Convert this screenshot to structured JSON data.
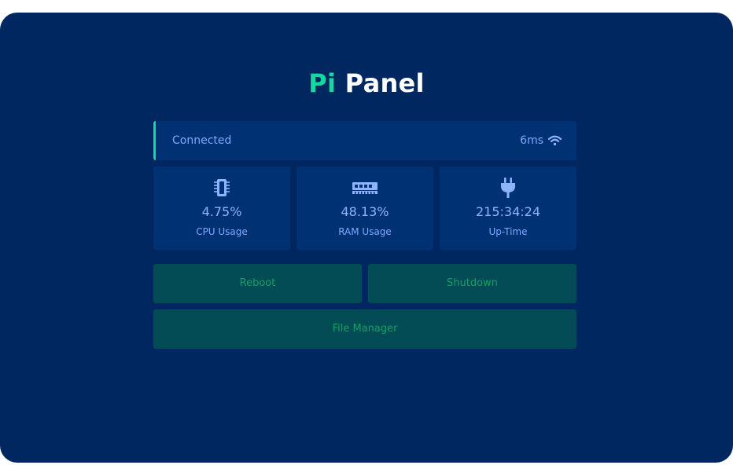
{
  "header": {
    "title_accent": "Pi",
    "title_main": "Panel"
  },
  "status": {
    "text": "Connected",
    "latency": "6ms",
    "icon": "wifi-icon"
  },
  "stats": [
    {
      "icon": "cpu-chip-icon",
      "value": "4.75%",
      "label": "CPU Usage"
    },
    {
      "icon": "memory-ram-icon",
      "value": "48.13%",
      "label": "RAM Usage"
    },
    {
      "icon": "power-plug-icon",
      "value": "215:34:24",
      "label": "Up-Time"
    }
  ],
  "actions": {
    "reboot": "Reboot",
    "shutdown": "Shutdown",
    "file_manager": "File Manager"
  },
  "colors": {
    "background": "#002760",
    "panel": "#003173",
    "accent": "#13d8a0",
    "text": "#7ea8ff",
    "button_bg": "#034c55",
    "button_text": "#11a060"
  }
}
